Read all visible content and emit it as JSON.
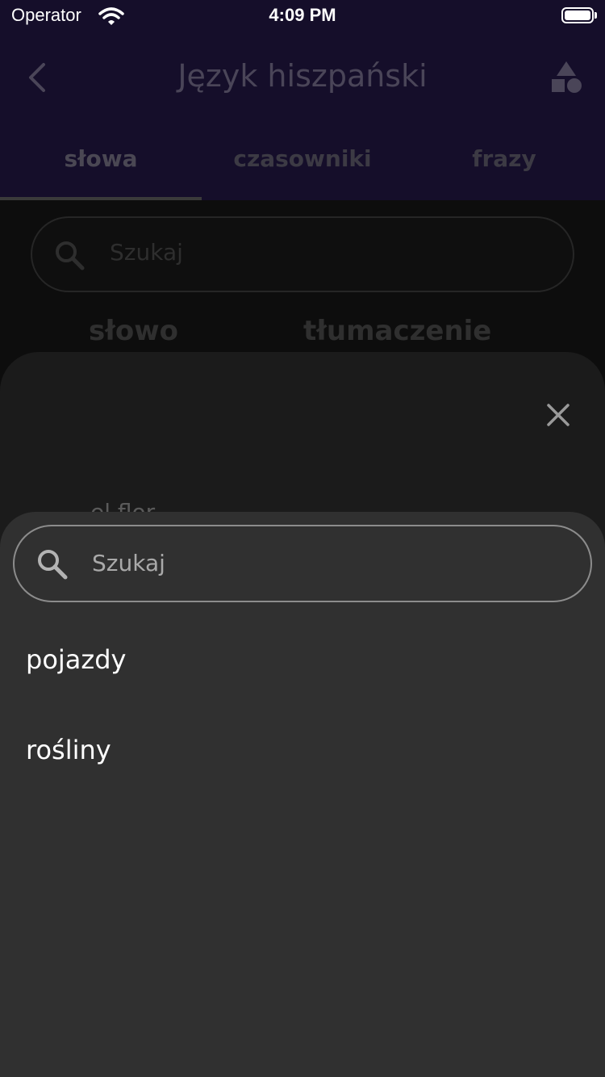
{
  "status_bar": {
    "carrier": "Operator",
    "time": "4:09 PM"
  },
  "header": {
    "title": "Język hiszpański",
    "tabs": [
      "słowa",
      "czasowniki",
      "frazy"
    ]
  },
  "background_list": {
    "search_placeholder": "Szukaj",
    "column_word": "słowo",
    "column_translation": "tłumaczenie",
    "peek_word": "el flor"
  },
  "category_picker": {
    "search_placeholder": "Szukaj",
    "options": [
      "pojazdy",
      "rośliny"
    ]
  }
}
